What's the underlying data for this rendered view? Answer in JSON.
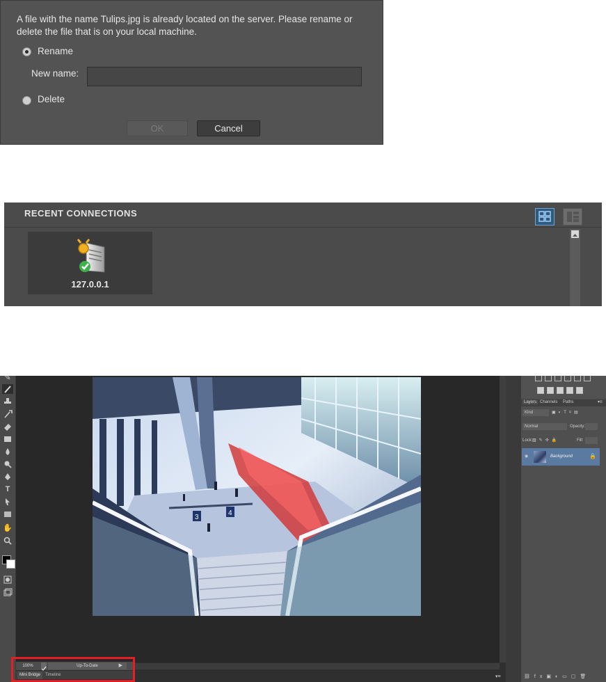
{
  "dialog": {
    "message": "A file with the name Tulips.jpg is already located on the server. Please rename or delete the file that is on your local machine.",
    "rename_label": "Rename",
    "new_name_label": "New name:",
    "new_name_value": "",
    "delete_label": "Delete",
    "ok_label": "OK",
    "cancel_label": "Cancel",
    "selected_option": "Rename"
  },
  "recent_connections": {
    "title": "RECENT CONNECTIONS",
    "view_modes": [
      "grid-view-icon",
      "list-view-icon"
    ],
    "active_view": "grid",
    "items": [
      {
        "label": "127.0.0.1",
        "icon": "server-connected-icon"
      }
    ]
  },
  "photoshop": {
    "tools": [
      "brush-icon",
      "stamp-icon",
      "history-brush-icon",
      "eraser-icon",
      "gradient-icon",
      "blur-icon",
      "dodge-icon",
      "pen-icon",
      "type-icon",
      "path-select-icon",
      "rectangle-icon",
      "hand-icon",
      "zoom-icon"
    ],
    "panel_tabs": [
      "Layers",
      "Channels",
      "Paths"
    ],
    "kind_filter": "Kind",
    "blend_mode": "Normal",
    "opacity_label": "Opacity:",
    "lock_label": "Lock:",
    "fill_label": "Fill:",
    "layer_name": "Background",
    "zoom": "100%",
    "status": "Up-To-Date",
    "bottom_tabs": [
      "Mini Bridge",
      "Timeline"
    ],
    "active_bottom_tab": "Mini Bridge",
    "highlight_color": "#e31e24"
  }
}
